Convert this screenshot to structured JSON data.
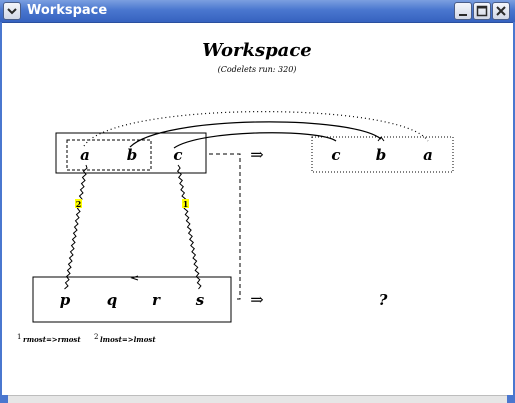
{
  "window": {
    "title": "Workspace",
    "buttons": {
      "minimize": "minimize",
      "maximize": "maximize",
      "close": "close"
    }
  },
  "workspace": {
    "heading": "Workspace",
    "codelets": "(Codelets run: 320)",
    "initial_string": [
      "a",
      "b",
      "c"
    ],
    "modified_string": [
      "c",
      "b",
      "a"
    ],
    "target_string": [
      "p",
      "q",
      "r",
      "s"
    ],
    "answer": "?",
    "arrow_glyph": "⇒",
    "bridge_labels": [
      "2",
      "1"
    ],
    "footnotes": [
      {
        "num": "1",
        "text": "rmost=>rmost"
      },
      {
        "num": "2",
        "text": "lmost=>lmost"
      }
    ]
  },
  "colors": {
    "title_gradient_top": "#7c9fe0",
    "title_gradient_bottom": "#3662bf",
    "highlight": "#ffff00"
  }
}
